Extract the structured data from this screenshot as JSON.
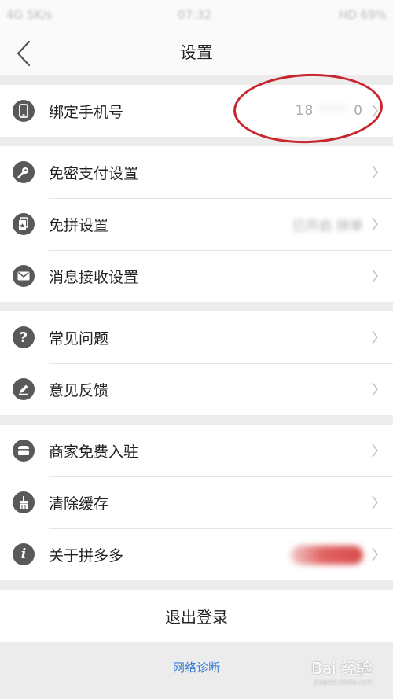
{
  "status_bar": {
    "left": "4G 5K/s",
    "time": "07:32",
    "right": "HD 69%"
  },
  "header": {
    "title": "设置"
  },
  "groups": [
    {
      "items": [
        {
          "label": "绑定手机号",
          "icon": "phone-icon",
          "value_prefix": "18",
          "value_masked": " ****",
          "value_suffix": "0"
        }
      ]
    },
    {
      "items": [
        {
          "label": "免密支付设置",
          "icon": "key-icon"
        },
        {
          "label": "免拼设置",
          "icon": "card-icon",
          "value": "已开启 拼单"
        },
        {
          "label": "消息接收设置",
          "icon": "mail-icon"
        }
      ]
    },
    {
      "items": [
        {
          "label": "常见问题",
          "icon": "question-icon"
        },
        {
          "label": "意见反馈",
          "icon": "pencil-icon"
        }
      ]
    },
    {
      "items": [
        {
          "label": "商家免费入驻",
          "icon": "store-icon"
        },
        {
          "label": "清除缓存",
          "icon": "broom-icon"
        },
        {
          "label": "关于拼多多",
          "icon": "info-icon"
        }
      ]
    }
  ],
  "logout": {
    "label": "退出登录"
  },
  "footer": {
    "link": "网络诊断"
  },
  "watermark": {
    "text": "Bai 经验",
    "sub": "jingyan.baidu.com"
  },
  "colors": {
    "highlight_circle": "#c8262e",
    "link": "#3a7bd5",
    "icon_bg": "#595959"
  }
}
